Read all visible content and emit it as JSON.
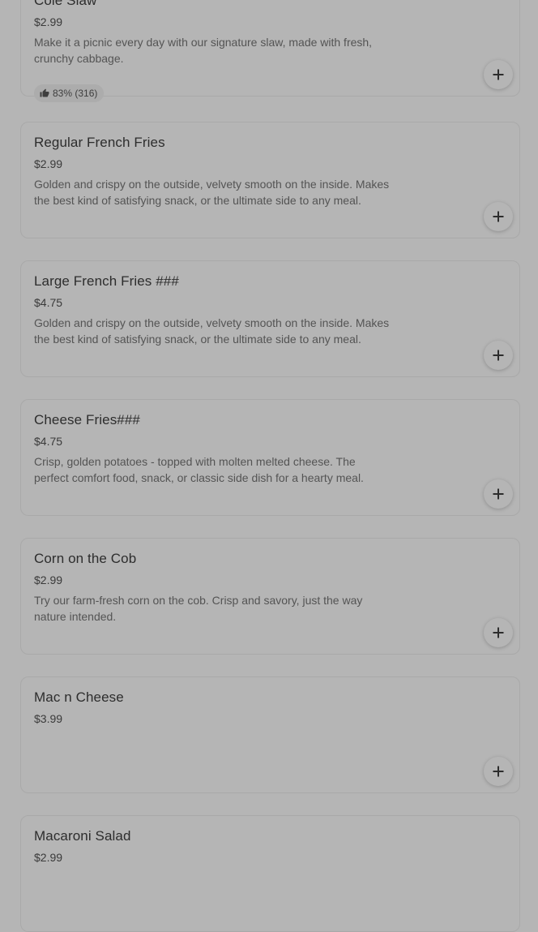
{
  "menu": {
    "items": [
      {
        "name": "Cole Slaw",
        "price": "$2.99",
        "description": "Make it a picnic every day with our signature slaw, made with fresh, crunchy cabbage.",
        "rating": "83% (316)"
      },
      {
        "name": "Regular French Fries",
        "price": "$2.99",
        "description": "Golden and crispy on the outside, velvety smooth on the inside. Makes the best kind of satisfying snack, or the ultimate side to any meal."
      },
      {
        "name": "Large French Fries ###",
        "price": "$4.75",
        "description": "Golden and crispy on the outside, velvety smooth on the inside. Makes the best kind of satisfying snack, or the ultimate side to any meal."
      },
      {
        "name": "Cheese Fries###",
        "price": "$4.75",
        "description": "Crisp, golden potatoes - topped with molten melted cheese. The perfect comfort food, snack, or classic side dish for a hearty meal."
      },
      {
        "name": "Corn on the Cob",
        "price": "$2.99",
        "description": "Try our farm-fresh corn on the cob. Crisp and savory, just the way nature intended."
      },
      {
        "name": "Mac n Cheese",
        "price": "$3.99",
        "description": ""
      },
      {
        "name": "Macaroni Salad",
        "price": "$2.99",
        "description": ""
      }
    ]
  },
  "icons": {
    "add": "plus-icon",
    "rating": "thumbs-up-icon"
  },
  "colors": {
    "overlay_background": "#b5b5b5",
    "card_border": "#a9a9a9",
    "title_text": "#2d2d2d",
    "description_text": "#545454"
  }
}
